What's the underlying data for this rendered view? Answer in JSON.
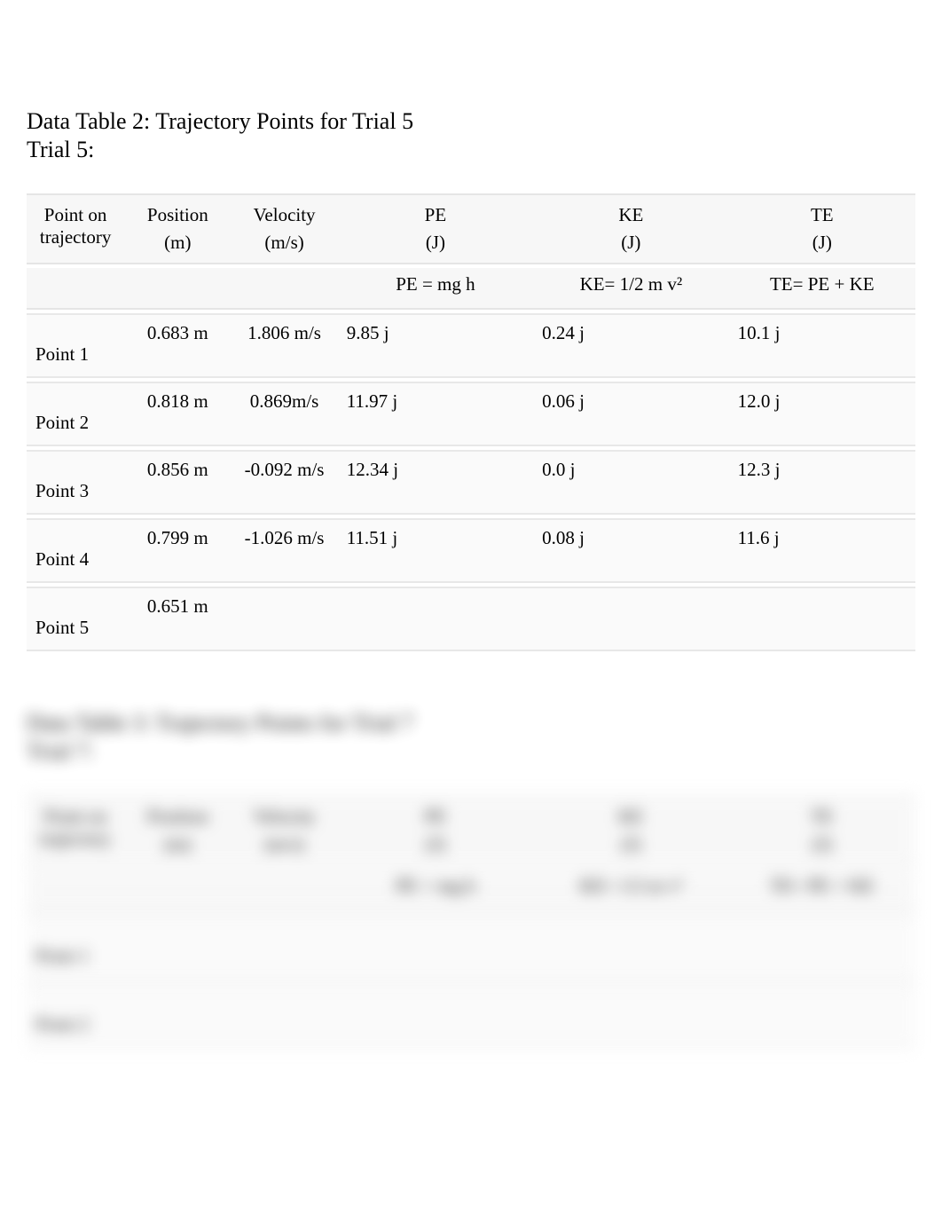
{
  "table2": {
    "title": "Data Table 2: Trajectory Points for Trial 5",
    "subtitle": "Trial 5:",
    "headers": {
      "point": "Point on trajectory",
      "position": "Position",
      "position_unit": "(m)",
      "velocity": "Velocity",
      "velocity_unit": "(m/s)",
      "pe": "PE",
      "pe_unit": "(J)",
      "ke": "KE",
      "ke_unit": "(J)",
      "te": "TE",
      "te_unit": "(J)"
    },
    "formulas": {
      "pe": "PE = mg h",
      "ke": "KE= 1/2 m v²",
      "te": "TE= PE + KE"
    },
    "rows": [
      {
        "point": "Point 1",
        "position": "0.683 m",
        "velocity": "1.806 m/s",
        "pe": "9.85 j",
        "ke": "0.24 j",
        "te": "10.1 j"
      },
      {
        "point": "Point 2",
        "position": "0.818 m",
        "velocity": "0.869m/s",
        "pe": "11.97 j",
        "ke": "0.06 j",
        "te": "12.0 j"
      },
      {
        "point": "Point 3",
        "position": "0.856 m",
        "velocity": "-0.092 m/s",
        "pe": "12.34 j",
        "ke": "0.0 j",
        "te": "12.3 j"
      },
      {
        "point": "Point 4",
        "position": "0.799 m",
        "velocity": "-1.026 m/s",
        "pe": "11.51 j",
        "ke": "0.08 j",
        "te": "11.6 j"
      },
      {
        "point": "Point 5",
        "position": "0.651 m",
        "velocity": "",
        "pe": "",
        "ke": "",
        "te": ""
      }
    ]
  },
  "table3": {
    "title": "Data Table 3: Trajectory Points for Trial 7",
    "subtitle": "Trial 7:",
    "headers": {
      "point": "Point on trajectory",
      "position": "Position",
      "position_unit": "(m)",
      "velocity": "Velocity",
      "velocity_unit": "(m/s)",
      "pe": "PE",
      "pe_unit": "(J)",
      "ke": "KE",
      "ke_unit": "(J)",
      "te": "TE",
      "te_unit": "(J)"
    },
    "formulas": {
      "pe": "PE = mg h",
      "ke": "KE= 1/2 m v²",
      "te": "TE= PE + KE"
    },
    "rows": [
      {
        "point": "Point 1",
        "position": "",
        "velocity": "",
        "pe": "",
        "ke": "",
        "te": ""
      },
      {
        "point": "Point 2",
        "position": "",
        "velocity": "",
        "pe": "",
        "ke": "",
        "te": ""
      }
    ]
  }
}
